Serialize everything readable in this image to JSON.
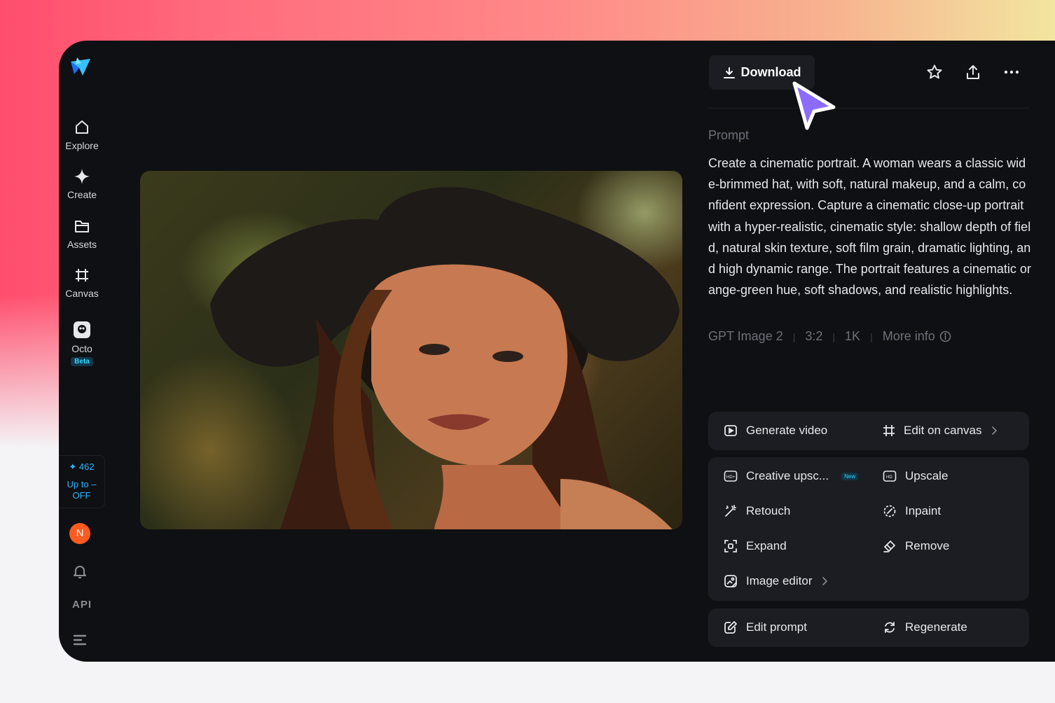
{
  "colors": {
    "app_bg": "#0f1013",
    "panel_bg": "#1c1d22",
    "accent_cyan": "#38d6ff",
    "credits_blue": "#2fb6ff",
    "avatar_orange": "#ff5a1f",
    "cursor_purple": "#8b6cff"
  },
  "sidebar": {
    "logo": "app-logo",
    "items": [
      {
        "label": "Explore",
        "icon": "home-icon"
      },
      {
        "label": "Create",
        "icon": "sparkle-icon"
      },
      {
        "label": "Assets",
        "icon": "folder-icon"
      },
      {
        "label": "Canvas",
        "icon": "canvas-icon"
      },
      {
        "label": "Octo",
        "icon": "octo-icon",
        "badge": "Beta"
      }
    ],
    "credits": {
      "count": "462",
      "line1": "Up to –",
      "line2": "OFF"
    },
    "avatar_initial": "N",
    "api_label": "API"
  },
  "toolbar": {
    "download_label": "Download",
    "icons": [
      "star-icon",
      "share-icon",
      "more-icon"
    ]
  },
  "prompt": {
    "label": "Prompt",
    "text": "Create a cinematic portrait. A woman wears a classic wide-brimmed hat, with soft, natural makeup, and a calm, confident expression. Capture a cinematic close-up portrait with a hyper-realistic, cinematic style: shallow depth of field, natural skin texture, soft film grain, dramatic lighting, and high dynamic range. The portrait features a cinematic orange-green hue, soft shadows, and realistic highlights."
  },
  "meta": {
    "model": "GPT Image 2",
    "ratio": "3:2",
    "resolution": "1K",
    "more_info": "More info"
  },
  "actions": {
    "generate_video": "Generate video",
    "edit_on_canvas": "Edit on canvas",
    "creative_upscale": "Creative upsc...",
    "new_badge": "New",
    "upscale": "Upscale",
    "retouch": "Retouch",
    "inpaint": "Inpaint",
    "expand": "Expand",
    "remove": "Remove",
    "image_editor": "Image editor",
    "edit_prompt": "Edit prompt",
    "regenerate": "Regenerate"
  }
}
